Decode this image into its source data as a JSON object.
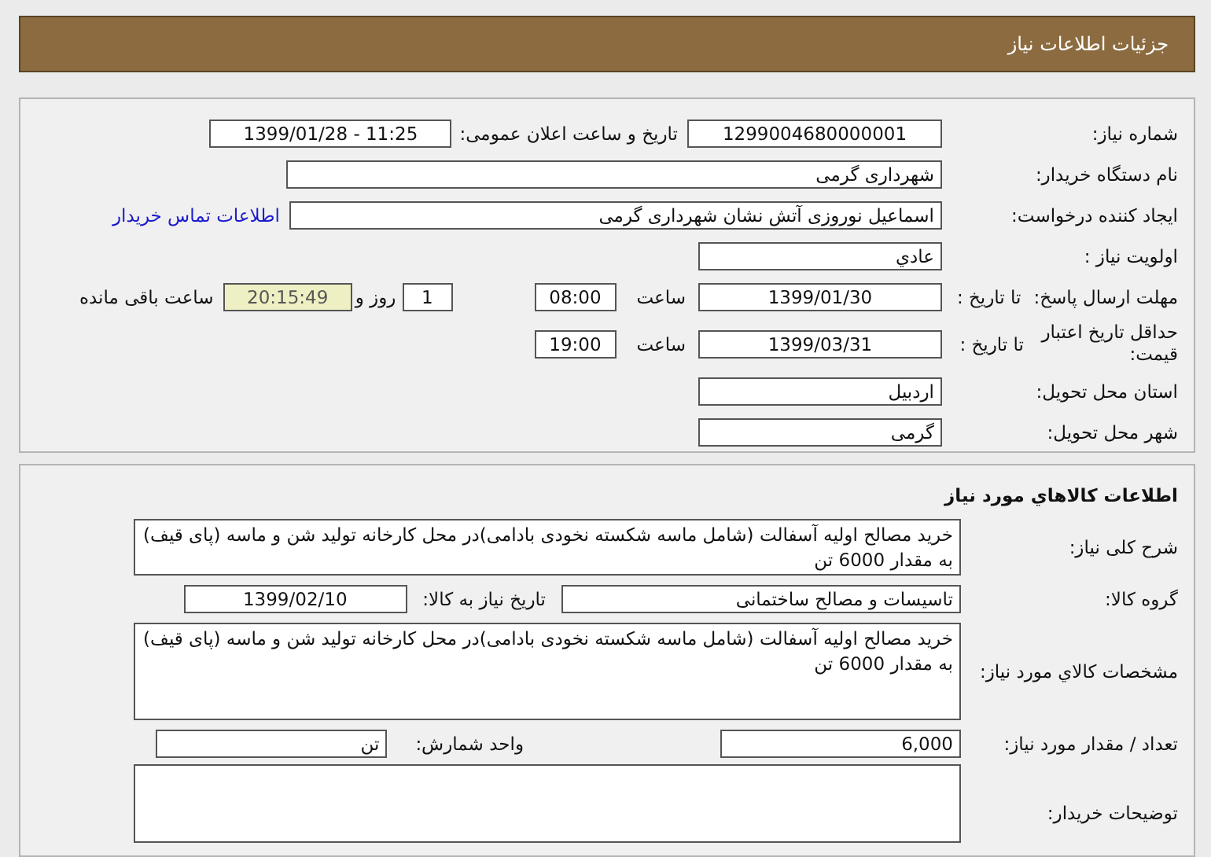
{
  "header": {
    "title": "جزئیات اطلاعات نیاز"
  },
  "details": [
    {
      "label": "شماره نیاز:",
      "items": [
        {
          "kind": "field",
          "value": "1299004680000001"
        },
        {
          "kind": "text",
          "text": "تاریخ و ساعت اعلان عمومی:"
        },
        {
          "kind": "field",
          "value": "1399/01/28 - 11:25"
        }
      ]
    },
    {
      "label": "نام دستگاه خریدار:",
      "items": [
        {
          "kind": "field",
          "value": "شهرداری گرمی"
        }
      ]
    },
    {
      "label": "ایجاد کننده درخواست:",
      "items": [
        {
          "kind": "field",
          "value": "اسماعیل نوروزی آتش نشان شهرداری گرمی"
        },
        {
          "kind": "link",
          "text": "اطلاعات تماس خریدار"
        }
      ]
    },
    {
      "label": "اولویت نیاز :",
      "items": [
        {
          "kind": "field",
          "value": "عادي"
        }
      ]
    },
    {
      "label": "مهلت ارسال پاسخ:",
      "sublabel": "تا تاریخ :",
      "items": [
        {
          "kind": "field",
          "value": "1399/01/30"
        },
        {
          "kind": "text",
          "text": "ساعت"
        },
        {
          "kind": "field",
          "value": "08:00"
        },
        {
          "kind": "field",
          "value": "1"
        },
        {
          "kind": "text",
          "text": "روز و"
        },
        {
          "kind": "counter",
          "value": "20:15:49"
        },
        {
          "kind": "text",
          "text": "ساعت باقی مانده"
        }
      ]
    },
    {
      "label": "حداقل تاریخ اعتبار قیمت:",
      "sublabel": "تا تاریخ :",
      "items": [
        {
          "kind": "field",
          "value": "1399/03/31"
        },
        {
          "kind": "text",
          "text": "ساعت"
        },
        {
          "kind": "field",
          "value": "19:00"
        }
      ]
    },
    {
      "label": "استان محل تحویل:",
      "items": [
        {
          "kind": "field",
          "value": "اردبیل"
        }
      ]
    },
    {
      "label": "شهر محل تحویل:",
      "items": [
        {
          "kind": "field",
          "value": "گرمی"
        }
      ]
    }
  ],
  "goods": {
    "title": "اطلاعات کالاهاي مورد نياز",
    "rows": [
      {
        "label": "شرح کلی نیاز:",
        "items": [
          {
            "kind": "area",
            "value": "خرید مصالح اولیه آسفالت (شامل ماسه شکسته نخودی بادامی)در محل کارخانه تولید شن و ماسه (پای قیف) به مقدار 6000 تن"
          }
        ]
      },
      {
        "label": "گروه کالا:",
        "items": [
          {
            "kind": "field",
            "value": "تاسیسات و مصالح ساختمانی"
          },
          {
            "kind": "text",
            "text": "تاریخ نیاز به کالا:"
          },
          {
            "kind": "field",
            "value": "1399/02/10"
          }
        ]
      },
      {
        "label": "مشخصات کالاي مورد نیاز:",
        "items": [
          {
            "kind": "area",
            "value": "خرید مصالح اولیه آسفالت (شامل ماسه شکسته نخودی بادامی)در محل کارخانه تولید شن و ماسه (پای قیف) به مقدار 6000 تن"
          }
        ]
      },
      {
        "label": "تعداد / مقدار مورد نیاز:",
        "items": [
          {
            "kind": "field",
            "value": "6,000"
          },
          {
            "kind": "text",
            "text": "واحد شمارش:"
          },
          {
            "kind": "field",
            "value": "تن"
          }
        ]
      },
      {
        "label": "توضیحات خریدار:",
        "items": [
          {
            "kind": "area"
          }
        ]
      }
    ]
  }
}
